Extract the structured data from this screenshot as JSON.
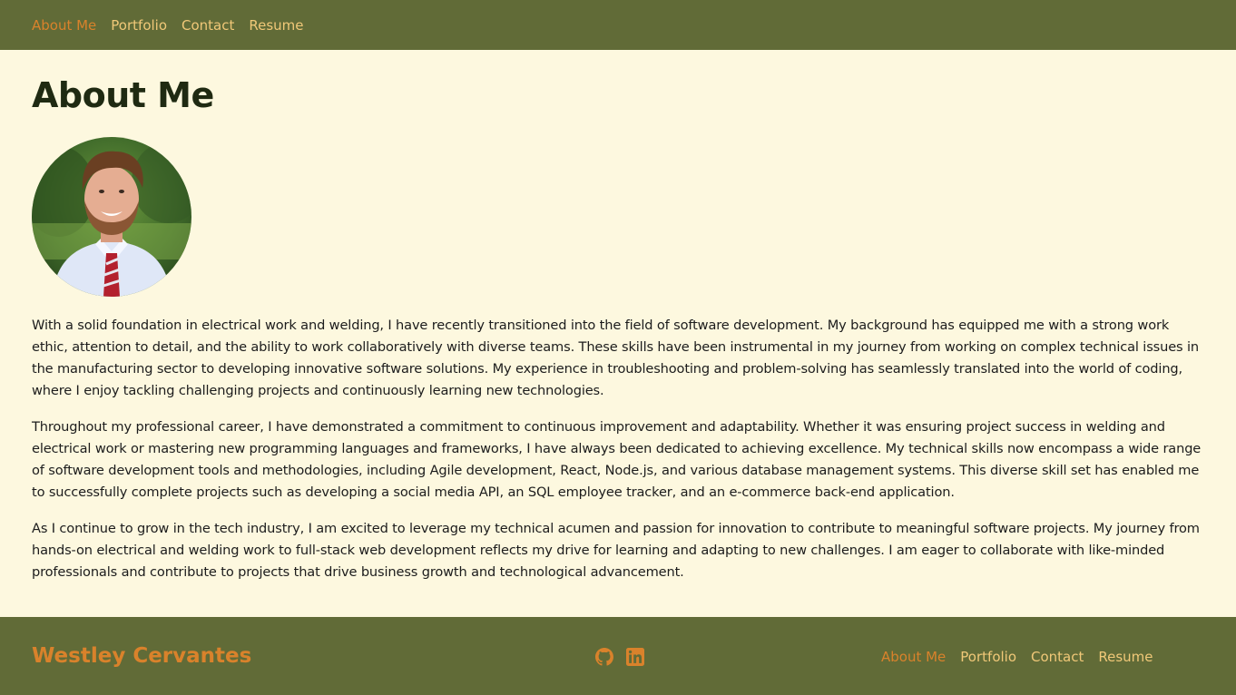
{
  "nav": {
    "items": [
      {
        "label": "About Me"
      },
      {
        "label": "Portfolio"
      },
      {
        "label": "Contact"
      },
      {
        "label": "Resume"
      }
    ]
  },
  "main": {
    "title": "About Me",
    "paragraphs": [
      "With a solid foundation in electrical work and welding, I have recently transitioned into the field of software development. My background has equipped me with a strong work ethic, attention to detail, and the ability to work collaboratively with diverse teams. These skills have been instrumental in my journey from working on complex technical issues in the manufacturing sector to developing innovative software solutions. My experience in troubleshooting and problem-solving has seamlessly translated into the world of coding, where I enjoy tackling challenging projects and continuously learning new technologies.",
      "Throughout my professional career, I have demonstrated a commitment to continuous improvement and adaptability. Whether it was ensuring project success in welding and electrical work or mastering new programming languages and frameworks, I have always been dedicated to achieving excellence. My technical skills now encompass a wide range of software development tools and methodologies, including Agile development, React, Node.js, and various database management systems. This diverse skill set has enabled me to successfully complete projects such as developing a social media API, an SQL employee tracker, and an e-commerce back-end application.",
      "As I continue to grow in the tech industry, I am excited to leverage my technical acumen and passion for innovation to contribute to meaningful software projects. My journey from hands-on electrical and welding work to full-stack web development reflects my drive for learning and adapting to new challenges. I am eager to collaborate with like-minded professionals and contribute to projects that drive business growth and technological advancement."
    ]
  },
  "footer": {
    "name": "Westley Cervantes",
    "icons": [
      "github-icon",
      "linkedin-icon"
    ]
  },
  "colors": {
    "bar": "#616b37",
    "background": "#fdf8df",
    "link": "#f0c878",
    "active_link": "#d9822b",
    "heading": "#1f2a12"
  }
}
